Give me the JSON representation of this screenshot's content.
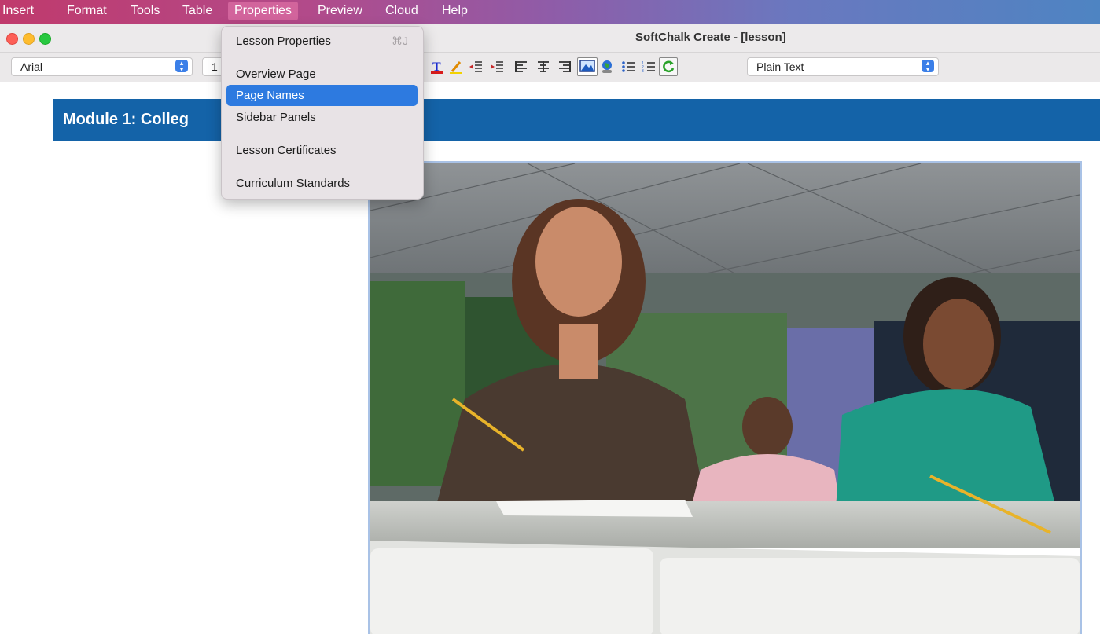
{
  "menubar": {
    "items": [
      "Insert",
      "Format",
      "Tools",
      "Table",
      "Properties",
      "Preview",
      "Cloud",
      "Help"
    ],
    "active": "Properties"
  },
  "window": {
    "title": "SoftChalk Create - [lesson]"
  },
  "toolbar": {
    "font_value": "Arial",
    "size_value": "1",
    "style_value": "Plain Text",
    "icons": [
      "text-color-icon",
      "highlight-pen-icon",
      "outdent-icon",
      "indent-icon",
      "align-left-icon",
      "align-center-icon",
      "align-right-icon",
      "insert-image-icon",
      "web-link-icon",
      "bullet-list-icon",
      "numbered-list-icon",
      "refresh-icon"
    ]
  },
  "dropdown": {
    "lesson_properties": "Lesson Properties",
    "lesson_properties_shortcut": "⌘J",
    "overview_page": "Overview Page",
    "page_names": "Page Names",
    "sidebar_panels": "Sidebar Panels",
    "lesson_certificates": "Lesson Certificates",
    "curriculum_standards": "Curriculum Standards"
  },
  "document": {
    "heading": "Module 1: Colleg"
  },
  "colors": {
    "banner": "#1463a8",
    "highlight": "#2d7ae0",
    "menubar_start": "#c03a6c",
    "menubar_end": "#4e84c2"
  }
}
